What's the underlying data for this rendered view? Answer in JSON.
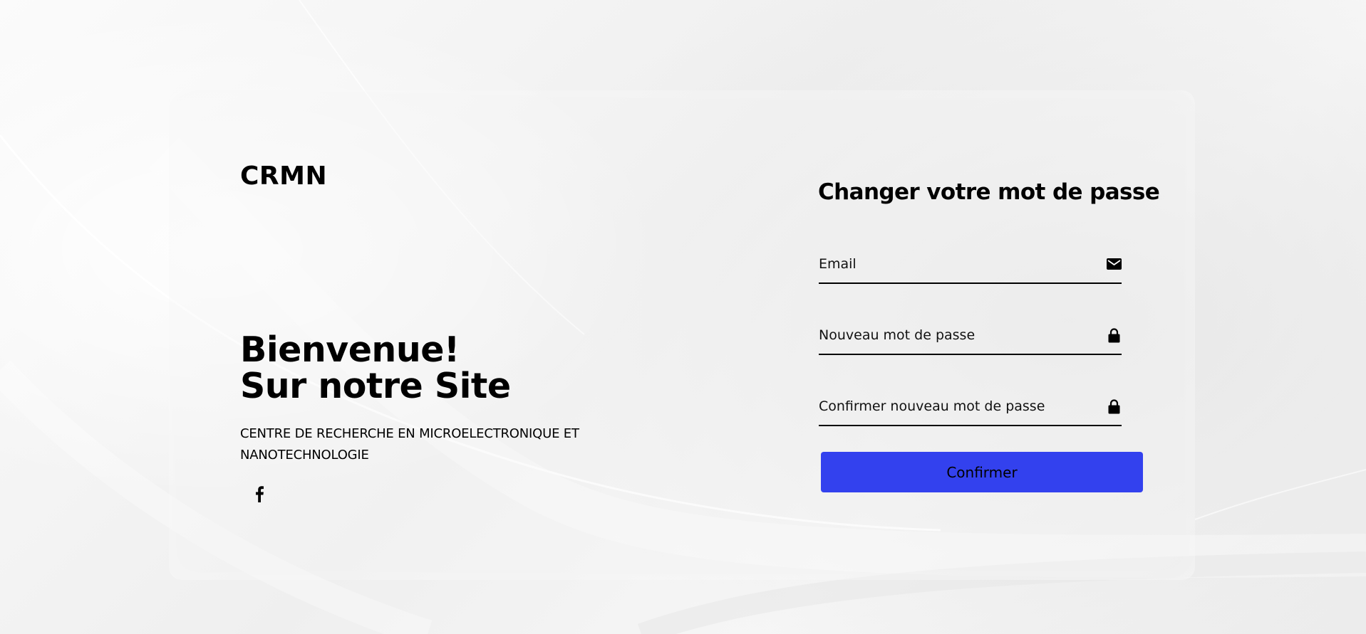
{
  "brand": {
    "name": "CRMN"
  },
  "hero": {
    "line1": "Bienvenue!",
    "line2": "Sur notre Site",
    "subtitle": "CENTRE DE RECHERCHE EN MICROELECTRONIQUE ET NANOTECHNOLOGIE"
  },
  "social": {
    "icon": "facebook-icon"
  },
  "form": {
    "title": "Changer votre mot de passe",
    "email": {
      "placeholder": "Email",
      "value": "",
      "icon": "envelope-icon"
    },
    "new_password": {
      "placeholder": "Nouveau mot de passe",
      "value": "",
      "icon": "lock-icon"
    },
    "confirm_password": {
      "placeholder": "Confirmer nouveau mot de passe",
      "value": "",
      "icon": "lock-icon"
    },
    "submit_label": "Confirmer"
  },
  "colors": {
    "button": "#3341ee",
    "text": "#000000",
    "background": "#f2f2f2"
  }
}
